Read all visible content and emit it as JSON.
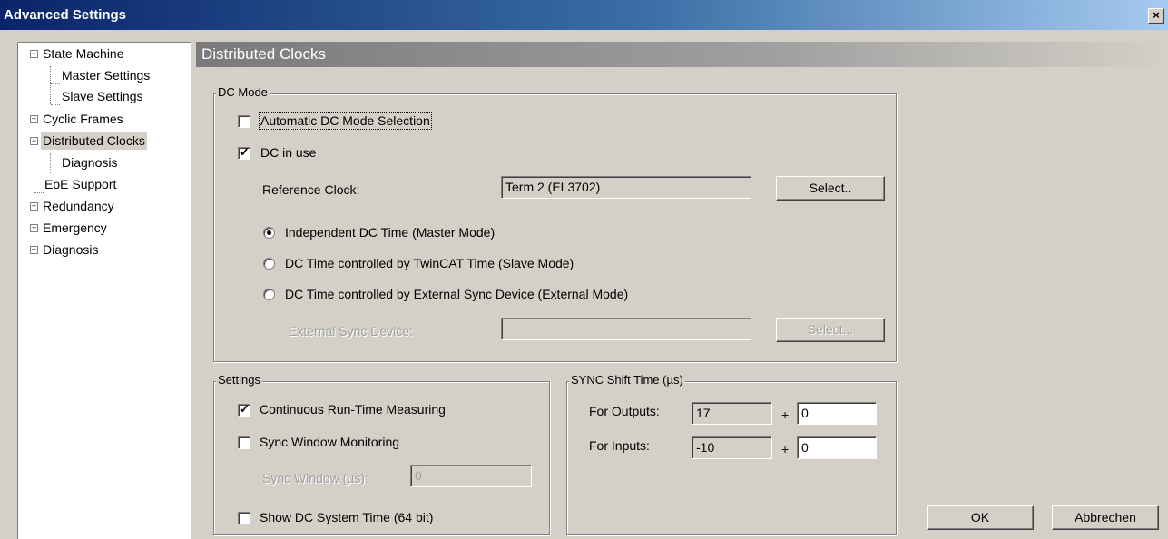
{
  "window": {
    "title": "Advanced Settings",
    "close_glyph": "×"
  },
  "tree": {
    "items": [
      {
        "label": "State Machine",
        "expander": "−"
      },
      {
        "label": "Master Settings"
      },
      {
        "label": "Slave Settings"
      },
      {
        "label": "Cyclic Frames",
        "expander": "+"
      },
      {
        "label": "Distributed Clocks",
        "expander": "−",
        "selected": true
      },
      {
        "label": "Diagnosis"
      },
      {
        "label": "EoE Support"
      },
      {
        "label": "Redundancy",
        "expander": "+"
      },
      {
        "label": "Emergency",
        "expander": "+"
      },
      {
        "label": "Diagnosis",
        "expander": "+"
      }
    ]
  },
  "panel": {
    "title": "Distributed Clocks",
    "dc_mode": {
      "title": "DC Mode",
      "auto_selection_label": "Automatic DC Mode Selection",
      "auto_selection_checked": false,
      "dc_in_use_label": "DC in use",
      "dc_in_use_checked": true,
      "reference_clock_label": "Reference Clock:",
      "reference_clock_value": "Term 2 (EL3702)",
      "select_button": "Select..",
      "radio_master": "Independent DC Time (Master Mode)",
      "radio_slave": "DC Time controlled by TwinCAT Time (Slave Mode)",
      "radio_external": "DC Time controlled by External Sync Device (External Mode)",
      "selected_mode": "master",
      "external_device_label": "External Sync Device:",
      "external_device_value": "",
      "external_select_button": "Select..."
    },
    "settings": {
      "title": "Settings",
      "continuous_label": "Continuous Run-Time Measuring",
      "continuous_checked": true,
      "sync_window_label": "Sync Window Monitoring",
      "sync_window_checked": false,
      "sync_window_value_label": "Sync Window (µs):",
      "sync_window_value": "0",
      "show_dc_label": "Show DC System Time (64 bit)",
      "show_dc_checked": false
    },
    "sync_shift": {
      "title": "SYNC Shift Time (µs)",
      "outputs_label": "For Outputs:",
      "outputs_base": "17",
      "outputs_add": "0",
      "inputs_label": "For Inputs:",
      "inputs_base": "-10",
      "inputs_add": "0",
      "plus": "+"
    }
  },
  "buttons": {
    "ok": "OK",
    "cancel": "Abbrechen"
  },
  "glyphs": {
    "check": "✓"
  }
}
